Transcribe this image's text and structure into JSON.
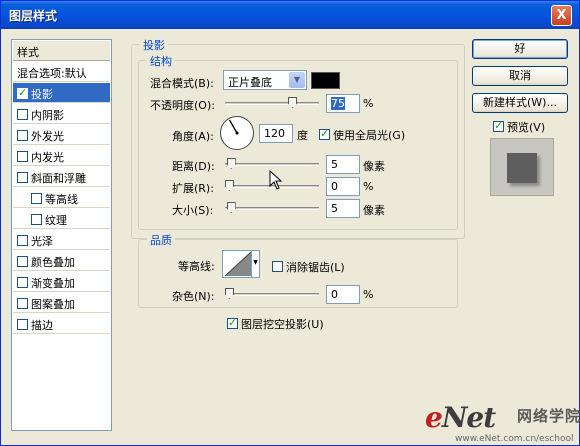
{
  "window": {
    "title": "图层样式",
    "close_label": "X"
  },
  "sidebar": {
    "header": "样式",
    "items": [
      {
        "label": "混合选项:默认",
        "checkbox": false,
        "checked": false,
        "selected": false,
        "indent": false
      },
      {
        "label": "投影",
        "checkbox": true,
        "checked": true,
        "selected": true,
        "indent": false
      },
      {
        "label": "内阴影",
        "checkbox": true,
        "checked": false,
        "selected": false,
        "indent": false
      },
      {
        "label": "外发光",
        "checkbox": true,
        "checked": false,
        "selected": false,
        "indent": false
      },
      {
        "label": "内发光",
        "checkbox": true,
        "checked": false,
        "selected": false,
        "indent": false
      },
      {
        "label": "斜面和浮雕",
        "checkbox": true,
        "checked": false,
        "selected": false,
        "indent": false
      },
      {
        "label": "等高线",
        "checkbox": true,
        "checked": false,
        "selected": false,
        "indent": true
      },
      {
        "label": "纹理",
        "checkbox": true,
        "checked": false,
        "selected": false,
        "indent": true
      },
      {
        "label": "光泽",
        "checkbox": true,
        "checked": false,
        "selected": false,
        "indent": false
      },
      {
        "label": "颜色叠加",
        "checkbox": true,
        "checked": false,
        "selected": false,
        "indent": false
      },
      {
        "label": "渐变叠加",
        "checkbox": true,
        "checked": false,
        "selected": false,
        "indent": false
      },
      {
        "label": "图案叠加",
        "checkbox": true,
        "checked": false,
        "selected": false,
        "indent": false
      },
      {
        "label": "描边",
        "checkbox": true,
        "checked": false,
        "selected": false,
        "indent": false
      }
    ]
  },
  "drop_shadow": {
    "group_title": "投影",
    "structure": {
      "group_title": "结构",
      "blend_mode_label": "混合模式(B):",
      "blend_mode_value": "正片叠底",
      "shadow_color": "#000000",
      "opacity_label": "不透明度(O):",
      "opacity_value": "75",
      "opacity_unit": "%",
      "opacity_level": 0.75,
      "angle_label": "角度(A):",
      "angle_value": "120",
      "angle_unit": "度",
      "global_light_label": "使用全局光(G)",
      "global_light_checked": true,
      "distance_label": "距离(D):",
      "distance_value": "5",
      "distance_unit": "像素",
      "distance_level": 0.02,
      "spread_label": "扩展(R):",
      "spread_value": "0",
      "spread_unit": "%",
      "spread_level": 0,
      "size_label": "大小(S):",
      "size_value": "5",
      "size_unit": "像素",
      "size_level": 0.02
    },
    "quality": {
      "group_title": "品质",
      "contour_label": "等高线:",
      "anti_alias_label": "消除锯齿(L)",
      "anti_alias_checked": false,
      "noise_label": "杂色(N):",
      "noise_value": "0",
      "noise_unit": "%",
      "noise_level": 0
    },
    "knockout_label": "图层挖空投影(U)",
    "knockout_checked": true
  },
  "buttons": {
    "ok": "好",
    "cancel": "取消",
    "new_style": "新建样式(W)..."
  },
  "preview": {
    "label": "预览(V)",
    "checked": true
  },
  "watermark": {
    "logo_e": "e",
    "logo_rest": "Net",
    "logo_cn": "网络学院",
    "url": "www.eNet.com.cn/eschool"
  }
}
